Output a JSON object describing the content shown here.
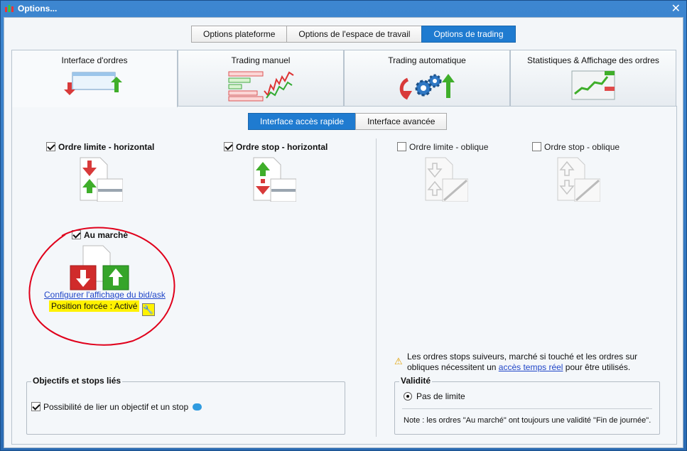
{
  "window": {
    "title": "Options..."
  },
  "top_tabs": [
    "Options plateforme",
    "Options de l'espace de travail",
    "Options de trading"
  ],
  "top_tabs_active": 2,
  "main_tabs": [
    "Interface d'ordres",
    "Trading manuel",
    "Trading automatique",
    "Statistiques & Affichage des ordres"
  ],
  "main_tabs_active": 0,
  "sub_tabs": [
    "Interface accès rapide",
    "Interface avancée"
  ],
  "sub_tabs_active": 0,
  "options": {
    "limit_horizontal": {
      "label": "Ordre limite - horizontal",
      "checked": true
    },
    "stop_horizontal": {
      "label": "Ordre stop - horizontal",
      "checked": true
    },
    "limit_oblique": {
      "label": "Ordre limite - oblique",
      "checked": false
    },
    "stop_oblique": {
      "label": "Ordre stop - oblique",
      "checked": false
    },
    "market": {
      "label": "Au marché",
      "checked": true
    }
  },
  "configure_bid_ask_link": "Configurer l'affichage du bid/ask",
  "forced_position": "Position forcée : Activé",
  "warning": {
    "text_before": "Les ordres stops suiveurs, marché si touché et les ordres sur obliques nécessitent un ",
    "link": "accès temps réel",
    "text_after": " pour être utilisés."
  },
  "objectives_group": {
    "title": "Objectifs et stops liés",
    "checkbox_label": "Possibilité de lier un objectif et un stop",
    "checked": true
  },
  "validity_group": {
    "title": "Validité",
    "radio_label": "Pas de limite",
    "note": "Note : les ordres \"Au marché\" ont toujours une validité \"Fin de journée\"."
  },
  "colors": {
    "accent": "#1f7bd0",
    "title_bar": "#2a6bb3",
    "annotation_circle": "#e0001b",
    "highlight": "#fff200"
  }
}
